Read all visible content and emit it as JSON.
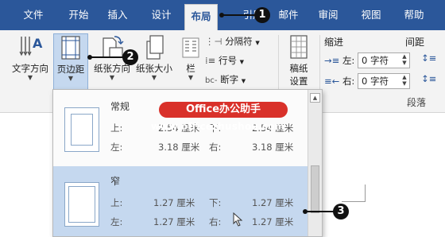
{
  "tabs": {
    "file": "文件",
    "home": "开始",
    "insert": "插入",
    "design": "设计",
    "layout": "布局",
    "references": "引用",
    "mailings": "邮件",
    "review": "审阅",
    "view": "视图",
    "help": "帮助"
  },
  "ribbon": {
    "text_direction": "文字方向",
    "margins": "页边距",
    "orientation": "纸张方向",
    "size": "纸张大小",
    "columns": "栏",
    "breaks": "分隔符",
    "line_numbers": "行号",
    "hyphenation": "断字",
    "grid_paper_line1": "稿纸",
    "grid_paper_line2": "设置",
    "indent_title": "缩进",
    "indent_left_label": "左:",
    "indent_left_value": "0 字符",
    "indent_right_label": "右:",
    "indent_right_value": "0 字符",
    "spacing_title": "间距",
    "paragraph_group": "段落"
  },
  "margins_gallery": {
    "options": [
      {
        "name": "常规",
        "top_label": "上:",
        "top_value": "2.54 厘米",
        "bottom_label": "下:",
        "bottom_value": "2.54 厘米",
        "left_label": "左:",
        "left_value": "3.18 厘米",
        "right_label": "右:",
        "right_value": "3.18 厘米"
      },
      {
        "name": "窄",
        "top_label": "上:",
        "top_value": "1.27 厘米",
        "bottom_label": "下:",
        "bottom_value": "1.27 厘米",
        "left_label": "左:",
        "left_value": "1.27 厘米",
        "right_label": "右:",
        "right_value": "1.27 厘米"
      }
    ]
  },
  "watermark": {
    "badge": "Office办公助手",
    "url": "www.officezhushou.com"
  },
  "callouts": [
    "1",
    "2",
    "3"
  ],
  "colors": {
    "tab_bar": "#2b579a",
    "ribbon_bg": "#f3f3f3",
    "selected_option": "#c5d8ef",
    "watermark_badge": "#d9312a"
  }
}
